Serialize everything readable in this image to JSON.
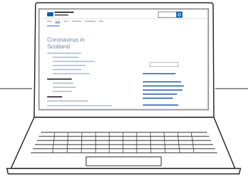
{
  "page": {
    "title_line1": "Coronavirus in",
    "title_line2": "Scotland",
    "nav_items": [
      "Home",
      "Topics",
      "About",
      "Publications",
      "Consultations",
      "News"
    ]
  }
}
